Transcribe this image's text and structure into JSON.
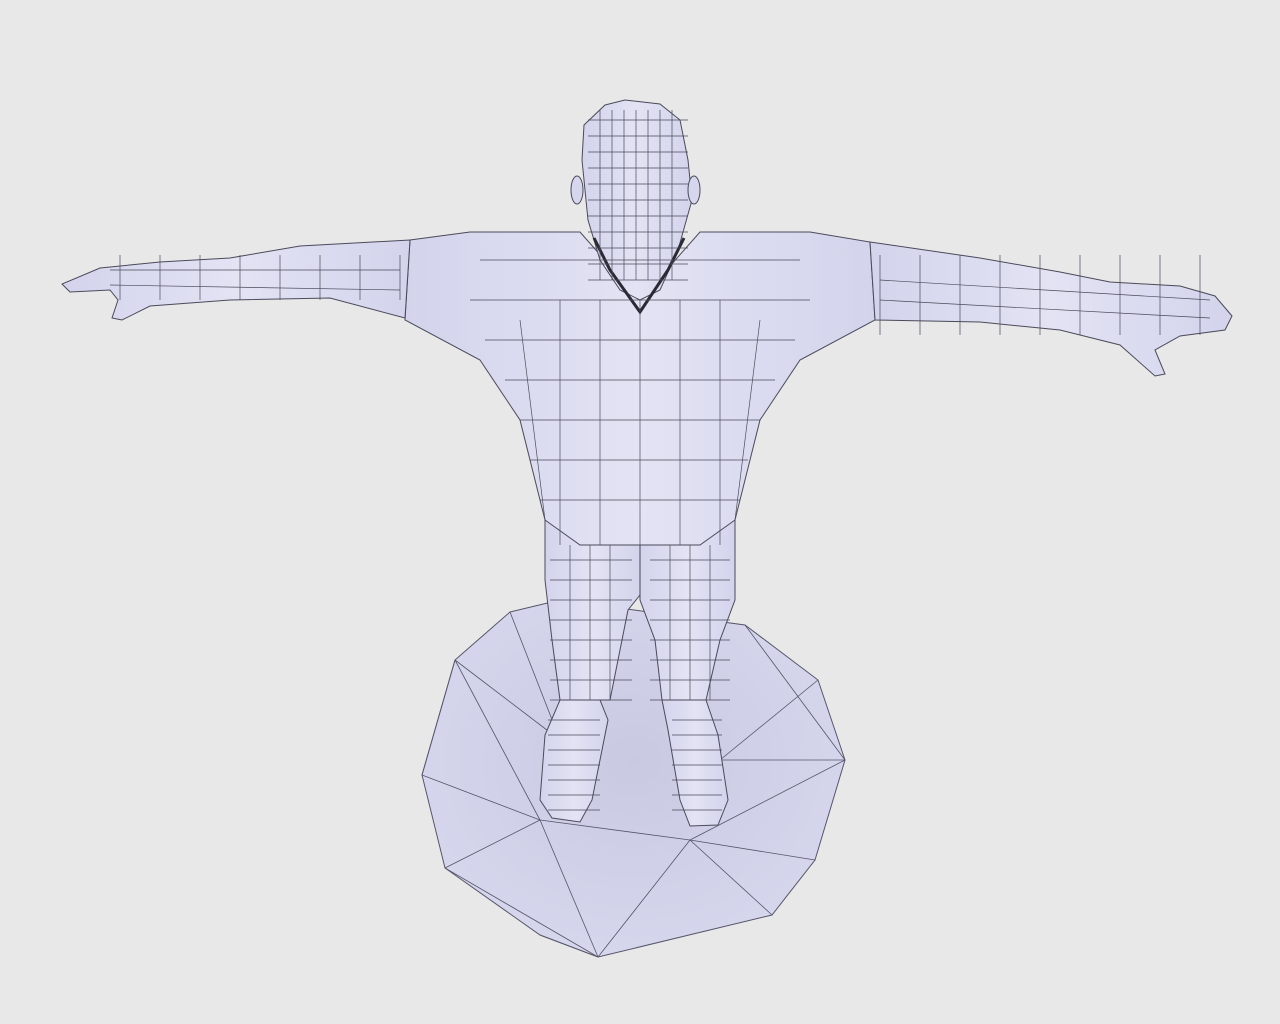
{
  "scene": {
    "background": "#e8e8e8",
    "mesh_fill": "#dcdcf0",
    "mesh_shadow": "#c8c8e0",
    "wire_color": "#4a4a5a",
    "pose": "T-pose",
    "base_shape": "low-poly polygon platform"
  }
}
